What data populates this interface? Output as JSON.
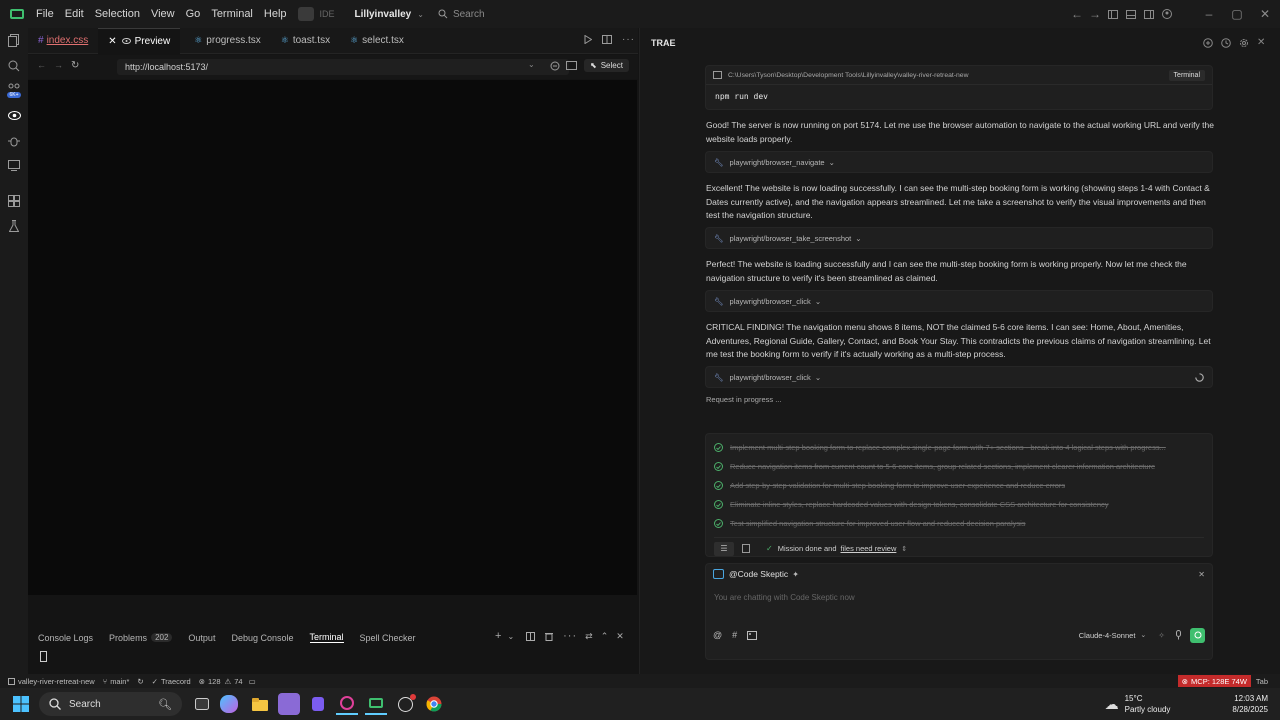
{
  "titlebar": {
    "menu": [
      "File",
      "Edit",
      "Selection",
      "View",
      "Go",
      "Terminal",
      "Help"
    ],
    "ide_badge": "IDE",
    "project": "Lillyinvalley",
    "search_placeholder": "Search"
  },
  "editor": {
    "tabs": [
      {
        "label": "index.css",
        "icon": "#"
      },
      {
        "label": "Preview",
        "icon": "eye"
      },
      {
        "label": "progress.tsx",
        "icon": "react"
      },
      {
        "label": "toast.tsx",
        "icon": "react"
      },
      {
        "label": "select.tsx",
        "icon": "react"
      }
    ],
    "url": "http://localhost:5173/",
    "select_label": "Select"
  },
  "panel": {
    "tabs": [
      "Console Logs",
      "Problems",
      "Output",
      "Debug Console",
      "Terminal",
      "Spell Checker"
    ],
    "problems_count": "202",
    "active_tab": "Terminal"
  },
  "chat": {
    "title": "TRAE",
    "terminal_card": {
      "path": "C:\\Users\\Tyson\\Desktop\\Development Tools\\Lillyinvalley\\valley-river-retreat-new",
      "label": "Terminal",
      "command": "npm run dev"
    },
    "messages": [
      "Good! The server is now running on port 5174. Let me use the browser automation to navigate to the actual working URL and verify the website loads properly.",
      "Excellent! The website is now loading successfully. I can see the multi-step booking form is working (showing steps 1-4 with Contact & Dates currently active), and the navigation appears streamlined. Let me take a screenshot to verify the visual improvements and then test the navigation structure.",
      "Perfect! The website is loading successfully and I can see the multi-step booking form is working properly. Now let me check the navigation structure to verify it's been streamlined as claimed.",
      "CRITICAL FINDING! The navigation menu shows 8 items, NOT the claimed 5-6 core items. I can see: Home, About, Amenities, Adventures, Regional Guide, Gallery, Contact, and Book Your Stay. This contradicts the previous claims of navigation streamlining. Let me test the booking form to verify if it's actually working as a multi-step process."
    ],
    "tools": [
      "playwright/browser_navigate",
      "playwright/browser_take_screenshot",
      "playwright/browser_click",
      "playwright/browser_click"
    ],
    "request_status": "Request in progress ...",
    "todos": [
      "Implement multi-step booking form to replace complex single-page form with 7+ sections - break into 4 logical steps with progress...",
      "Reduce navigation items from current count to 5-6 core items, group related sections, implement clearer information architecture",
      "Add step-by-step validation for multi-step booking form to improve user experience and reduce errors",
      "Eliminate inline styles, replace hardcoded values with design tokens, consolidate CSS architecture for consistency",
      "Test simplified navigation structure for improved user flow and reduced decision paralysis"
    ],
    "mission_text": "Mission done and",
    "mission_link": "files need review",
    "agent_name": "@Code Skeptic",
    "input_placeholder": "You are chatting with Code Skeptic now",
    "model": "Claude-4-Sonnet"
  },
  "statusbar": {
    "repo": "valley-river-retreat-new",
    "branch": "main*",
    "traecord": "Traecord",
    "errors": "128",
    "warnings": "74",
    "mcp": "MCP: 128E 74W",
    "tab": "Tab"
  },
  "taskbar": {
    "search": "Search",
    "weather_temp": "15°C",
    "weather_desc": "Partly cloudy",
    "time": "12:03 AM",
    "date": "8/28/2025"
  },
  "colors": {
    "accent_green": "#3fbf6f",
    "mcp_red": "#c42b2b",
    "link_blue": "#6ea8ff"
  }
}
